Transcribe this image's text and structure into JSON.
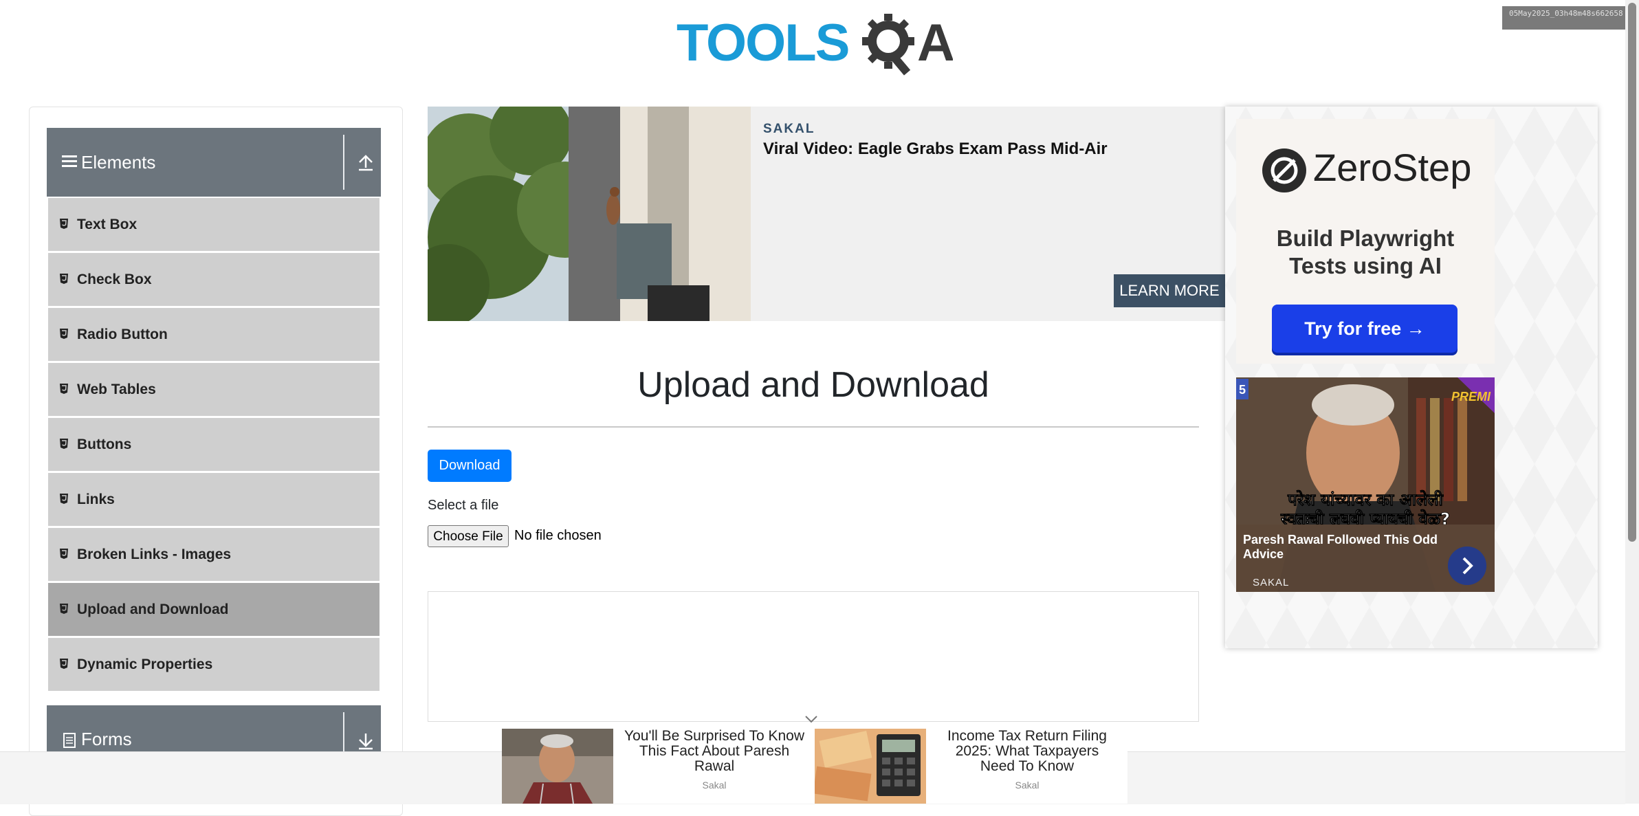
{
  "header": {
    "logo_text": "TOOLSQA"
  },
  "stamp": "05May2025_03h48m48s662658",
  "sidebar": {
    "groups": [
      {
        "title": "Elements"
      },
      {
        "title": "Forms"
      }
    ],
    "items": [
      {
        "label": "Text Box"
      },
      {
        "label": "Check Box"
      },
      {
        "label": "Radio Button"
      },
      {
        "label": "Web Tables"
      },
      {
        "label": "Buttons"
      },
      {
        "label": "Links"
      },
      {
        "label": "Broken Links - Images"
      },
      {
        "label": "Upload and Download"
      },
      {
        "label": "Dynamic Properties"
      }
    ],
    "active_item": "Upload and Download"
  },
  "ad_banner": {
    "source": "SAKAL",
    "headline": "Viral Video: Eagle Grabs Exam Pass Mid-Air",
    "cta": "LEARN MORE"
  },
  "right_ad": {
    "brand": "ZeroStep",
    "tagline_line1": "Build Playwright",
    "tagline_line2": "Tests using AI",
    "cta": "Try for free →",
    "video_title": "Paresh Rawal Followed This Odd Advice",
    "video_source": "SAKAL",
    "video_overlay_line1": "परेश यांच्यावर का आलेली",
    "video_overlay_line2": "स्वतःची लघवी प्यायची वेळ?",
    "video_badge": "PREMI"
  },
  "main": {
    "title": "Upload and Download",
    "download_label": "Download",
    "select_label": "Select a file",
    "choose_file_label": "Choose File",
    "file_status": "No file chosen"
  },
  "bottom_stories": [
    {
      "title": "You'll Be Surprised To Know This Fact About Paresh Rawal",
      "source": "Sakal"
    },
    {
      "title": "Income Tax Return Filing 2025: What Taxpayers Need To Know",
      "source": "Sakal"
    }
  ],
  "colors": {
    "brand_blue": "#1a9bd7",
    "group_header": "#6c757d",
    "menu_item": "#cfcfcf",
    "menu_active": "#a8a8a8",
    "primary_button": "#007bff",
    "cta_blue": "#1a3fe8"
  }
}
